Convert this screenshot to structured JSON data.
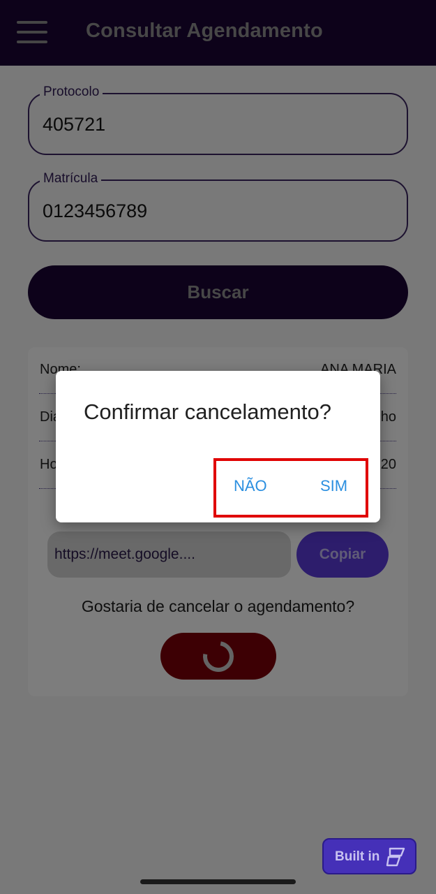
{
  "header": {
    "title": "Consultar Agendamento",
    "menu_icon": "hamburger-menu-icon"
  },
  "form": {
    "protocolo": {
      "label": "Protocolo",
      "value": "405721"
    },
    "matricula": {
      "label": "Matrícula",
      "value": "0123456789"
    },
    "search_button": "Buscar"
  },
  "result": {
    "rows": [
      {
        "key": "Nome:",
        "value": "ANA MARIA"
      },
      {
        "key": "Dia:",
        "value": "ho"
      },
      {
        "key": "Ho",
        "value": "20"
      }
    ],
    "link": "https://meet.google....",
    "copy_button": "Copiar",
    "cancel_question": "Gostaria de cancelar o agendamento?"
  },
  "dialog": {
    "title": "Confirmar cancelamento?",
    "no_button": "NÃO",
    "yes_button": "SIM"
  },
  "badge": {
    "label": "Built in"
  },
  "colors": {
    "app_bar": "#1a0435",
    "accent_purple": "#5b3ad8",
    "cancel_red": "#7a0008",
    "dialog_button": "#2b8fe0",
    "highlight": "#e00000"
  }
}
